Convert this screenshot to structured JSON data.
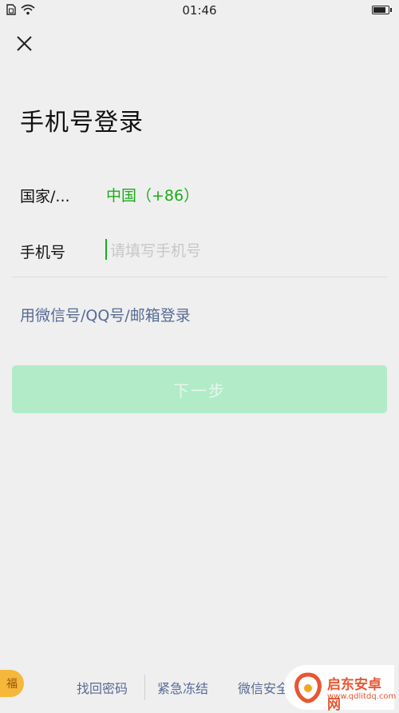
{
  "status_bar": {
    "time": "01:46"
  },
  "page": {
    "title": "手机号登录"
  },
  "form": {
    "country_label": "国家/...",
    "country_value": "中国（+86）",
    "phone_label": "手机号",
    "phone_placeholder": "请填写手机号",
    "phone_value": ""
  },
  "links": {
    "alt_login": "用微信号/QQ号/邮箱登录"
  },
  "actions": {
    "next_label": "下一步"
  },
  "footer": {
    "items": [
      "找回密码",
      "紧急冻结",
      "微信安全"
    ]
  },
  "badge": {
    "text": "福"
  },
  "watermark": {
    "text": "启东安卓网",
    "url": "www.qdlitdq.com"
  },
  "colors": {
    "accent_green": "#1aad19",
    "link_blue": "#576b95",
    "button_disabled": "#b2ebc8",
    "background": "#efefef"
  }
}
